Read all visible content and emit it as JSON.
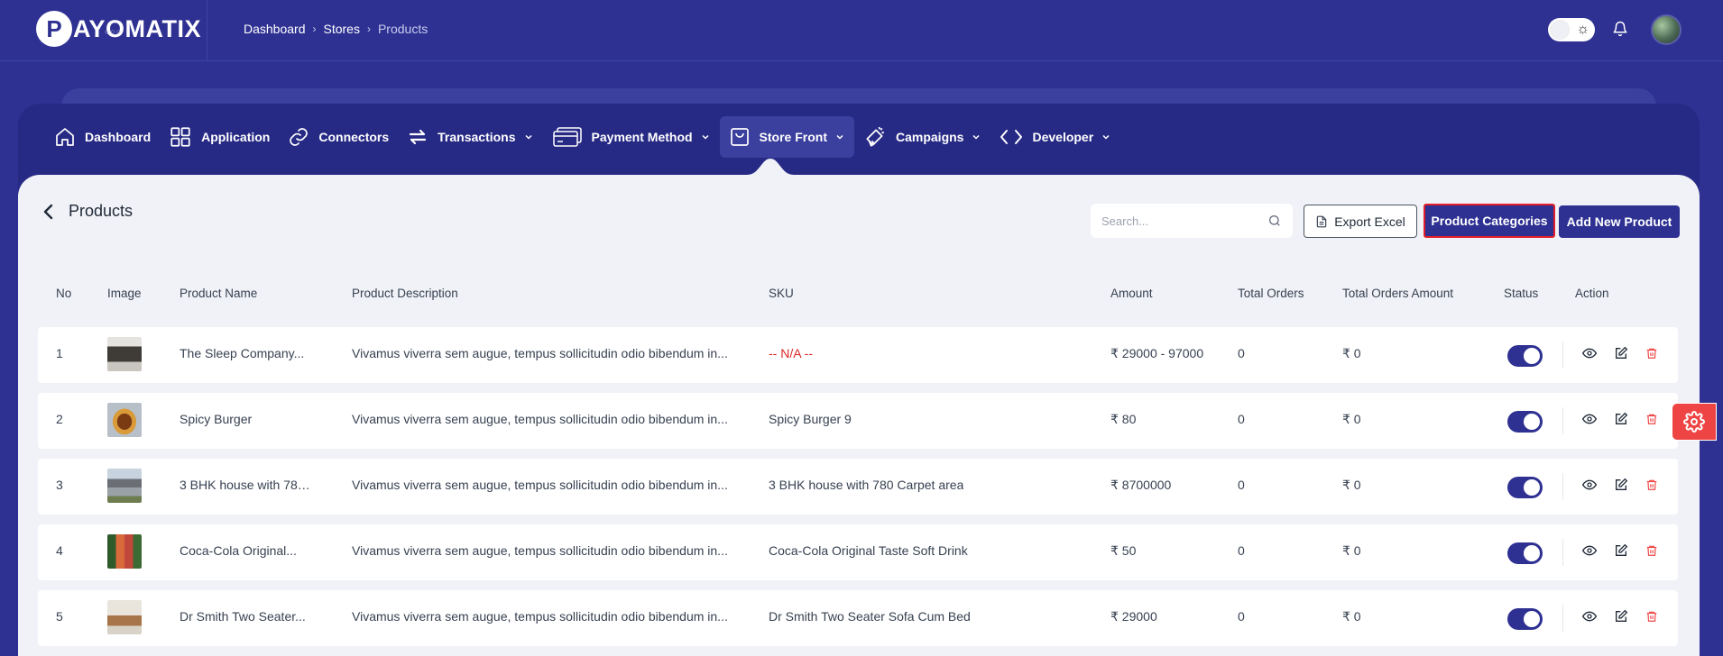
{
  "brand": {
    "logo_letter": "P",
    "name": "AYOMATIX",
    "dots": "○○○"
  },
  "breadcrumb": {
    "items": [
      "Dashboard",
      "Stores"
    ],
    "current": "Products"
  },
  "nav": {
    "items": [
      {
        "label": "Dashboard",
        "icon": "home-icon"
      },
      {
        "label": "Application",
        "icon": "grid-icon"
      },
      {
        "label": "Connectors",
        "icon": "link-icon"
      },
      {
        "label": "Transactions",
        "icon": "swap-icon",
        "has_dropdown": true
      },
      {
        "label": "Payment Method",
        "icon": "credit-card-icon",
        "has_dropdown": true
      },
      {
        "label": "Store Front",
        "icon": "shopping-bag-icon",
        "has_dropdown": true,
        "active": true
      },
      {
        "label": "Campaigns",
        "icon": "megaphone-icon",
        "has_dropdown": true
      },
      {
        "label": "Developer",
        "icon": "code-icon",
        "has_dropdown": true
      }
    ]
  },
  "page": {
    "title": "Products"
  },
  "toolbar": {
    "search_placeholder": "Search...",
    "export_label": "Export Excel",
    "categories_label": "Product Categories",
    "add_label": "Add New Product"
  },
  "table": {
    "columns": [
      "No",
      "Image",
      "Product Name",
      "Product Description",
      "SKU",
      "Amount",
      "Total Orders",
      "Total Orders Amount",
      "Status",
      "Action"
    ],
    "rows": [
      {
        "no": "1",
        "name": "The Sleep Company...",
        "description": "Vivamus viverra sem augue, tempus sollicitudin odio bibendum in...",
        "sku": "-- N/A --",
        "amount": "₹ 29000 - 97000",
        "total_orders": "0",
        "total_orders_amount": "₹ 0",
        "status": true,
        "image": "sofa-dark"
      },
      {
        "no": "2",
        "name": "Spicy Burger",
        "description": "Vivamus viverra sem augue, tempus sollicitudin odio bibendum in...",
        "sku": "Spicy Burger 9",
        "amount": "₹ 80",
        "total_orders": "0",
        "total_orders_amount": "₹ 0",
        "status": true,
        "image": "burger"
      },
      {
        "no": "3",
        "name": "3 BHK house with 780...",
        "description": "Vivamus viverra sem augue, tempus sollicitudin odio bibendum in...",
        "sku": "3 BHK house with 780 Carpet area",
        "amount": "₹ 8700000",
        "total_orders": "0",
        "total_orders_amount": "₹ 0",
        "status": true,
        "image": "house"
      },
      {
        "no": "4",
        "name": "Coca-Cola Original...",
        "description": "Vivamus viverra sem augue, tempus sollicitudin odio bibendum in...",
        "sku": "Coca-Cola Original Taste Soft Drink",
        "amount": "₹ 50",
        "total_orders": "0",
        "total_orders_amount": "₹ 0",
        "status": true,
        "image": "drink"
      },
      {
        "no": "5",
        "name": "Dr Smith Two Seater...",
        "description": "Vivamus viverra sem augue, tempus sollicitudin odio bibendum in...",
        "sku": "Dr Smith Two Seater Sofa Cum Bed",
        "amount": "₹ 29000",
        "total_orders": "0",
        "total_orders_amount": "₹ 0",
        "status": true,
        "image": "sofa-brown"
      }
    ]
  },
  "colors": {
    "primary": "#2e3192",
    "danger": "#ef4444",
    "highlight_border": "#e11d2a"
  }
}
